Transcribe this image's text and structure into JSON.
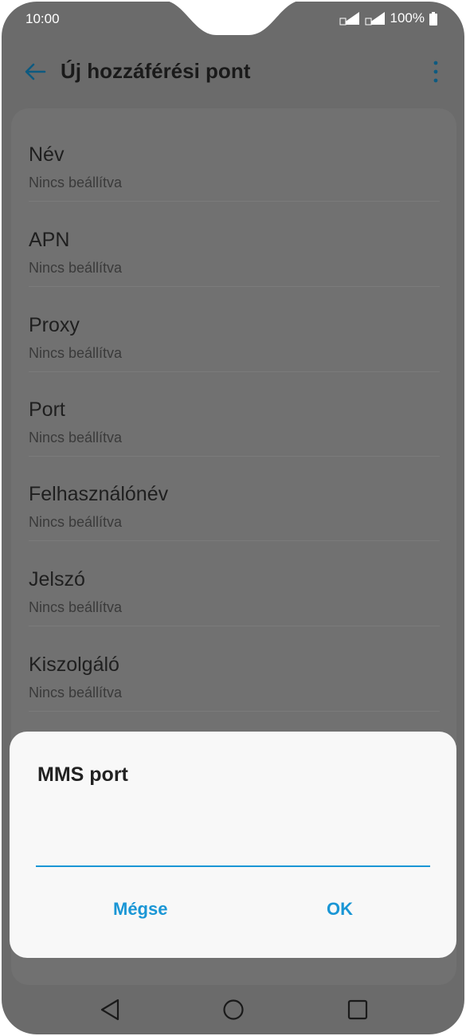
{
  "status_bar": {
    "time": "10:00",
    "battery": "100%"
  },
  "app_bar": {
    "title": "Új hozzáférési pont"
  },
  "list": {
    "items": [
      {
        "title": "Név",
        "subtitle": "Nincs beállítva"
      },
      {
        "title": "APN",
        "subtitle": "Nincs beállítva"
      },
      {
        "title": "Proxy",
        "subtitle": "Nincs beállítva"
      },
      {
        "title": "Port",
        "subtitle": "Nincs beállítva"
      },
      {
        "title": "Felhasználónév",
        "subtitle": "Nincs beállítva"
      },
      {
        "title": "Jelszó",
        "subtitle": "Nincs beállítva"
      },
      {
        "title": "Kiszolgáló",
        "subtitle": "Nincs beállítva"
      }
    ]
  },
  "dialog": {
    "title": "MMS port",
    "input_value": "",
    "cancel_label": "Mégse",
    "ok_label": "OK"
  },
  "colors": {
    "accent": "#1a96d5",
    "overlay": "#6b6b6b"
  }
}
